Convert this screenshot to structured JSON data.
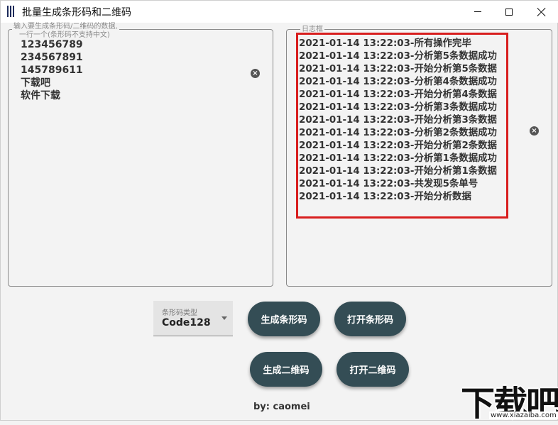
{
  "window": {
    "title": "批量生成条形码和二维码"
  },
  "input_panel": {
    "legend_line1": "输入要生成条形码/二维码的数据,",
    "legend_line2": "一行一个(条形码不支持中文)",
    "lines": [
      "123456789",
      "234567891",
      "145789611",
      "下载吧",
      "软件下载"
    ]
  },
  "log_panel": {
    "legend": "日志框",
    "lines": [
      "2021-01-14 13:22:03-所有操作完毕",
      "2021-01-14 13:22:03-分析第5条数据成功",
      "2021-01-14 13:22:03-开始分析第5条数据",
      "2021-01-14 13:22:03-分析第4条数据成功",
      "2021-01-14 13:22:03-开始分析第4条数据",
      "2021-01-14 13:22:03-分析第3条数据成功",
      "2021-01-14 13:22:03-开始分析第3条数据",
      "2021-01-14 13:22:03-分析第2条数据成功",
      "2021-01-14 13:22:03-开始分析第2条数据",
      "2021-01-14 13:22:03-分析第1条数据成功",
      "2021-01-14 13:22:03-开始分析第1条数据",
      "2021-01-14 13:22:03-共发现5条单号",
      "2021-01-14 13:22:03-开始分析数据"
    ],
    "highlight_color": "#d81e1e"
  },
  "barcode_type": {
    "label": "条形码类型",
    "value": "Code128"
  },
  "buttons": {
    "generate_barcode": "生成条形码",
    "open_barcode": "打开条形码",
    "generate_qrcode": "生成二维码",
    "open_qrcode": "打开二维码"
  },
  "footer": {
    "text": "by: caomei"
  },
  "watermark": {
    "text": "下载吧",
    "url": "www.xiazaiba.com"
  },
  "colors": {
    "button_bg": "#344d55",
    "window_bg": "#f3f3f3"
  }
}
